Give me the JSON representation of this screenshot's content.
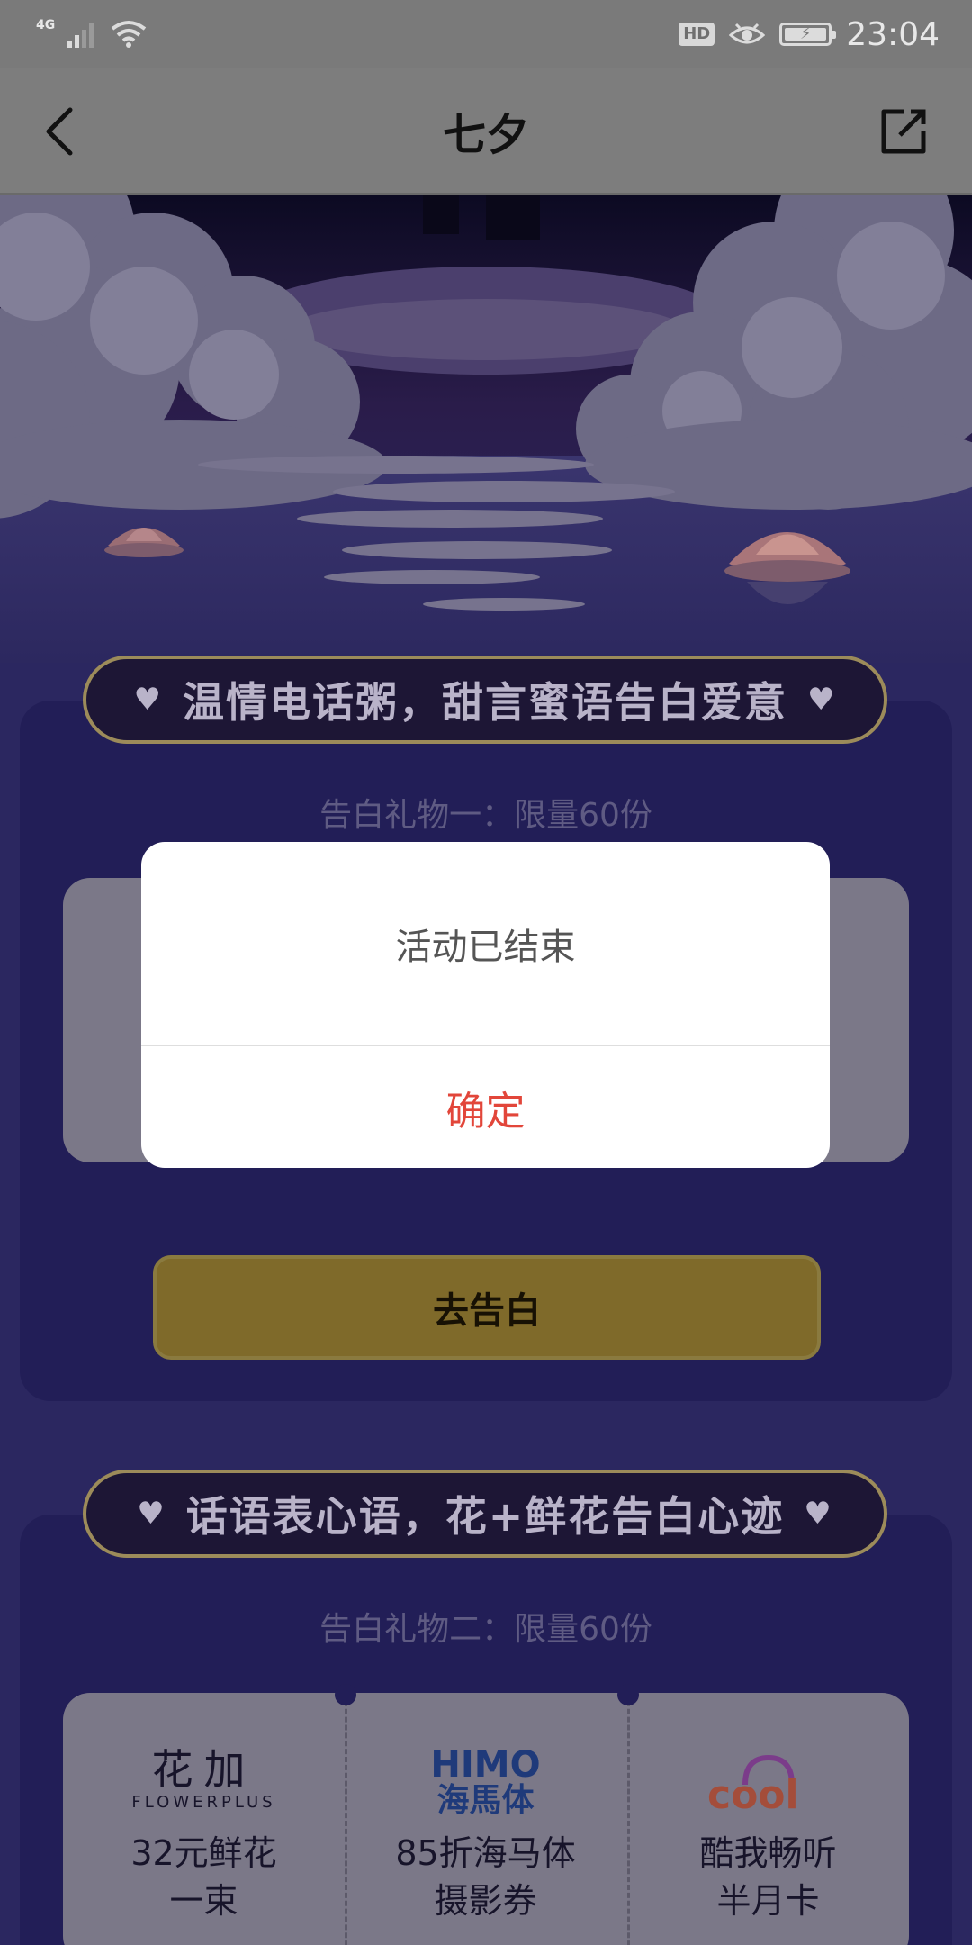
{
  "status_bar": {
    "network": "4G",
    "hd_badge": "HD",
    "time": "23:04",
    "icons": [
      "signal-icon",
      "wifi-icon",
      "eye-comfort-icon",
      "battery-charging-icon"
    ]
  },
  "header": {
    "title": "七夕",
    "back_icon": "chevron-left-icon",
    "share_icon": "share-external-icon"
  },
  "section1": {
    "banner": "温情电话粥，甜言蜜语告白爱意",
    "gift_label": "告白礼物一：限量60份",
    "button_label": "去告白"
  },
  "section2": {
    "banner": "话语表心语，花+鲜花告白心迹",
    "gift_label": "告白礼物二：限量60份",
    "gifts": [
      {
        "brand_main": "花加",
        "brand_sub": "FLOWERPLUS",
        "name_line1": "32元鲜花",
        "name_line2": "一束"
      },
      {
        "brand_main": "HIMO",
        "brand_sub": "海馬体",
        "name_line1": "85折海马体",
        "name_line2": "摄影券"
      },
      {
        "brand_main": "cool",
        "brand_sub": "",
        "name_line1": "酷我畅听",
        "name_line2": "半月卡"
      }
    ]
  },
  "dialog": {
    "message": "活动已结束",
    "confirm_label": "确定"
  },
  "colors": {
    "confirm_text": "#e2463a",
    "page_background": "#2b2760",
    "banner_border": "#9c8b5a",
    "button_gold": "#7f6a2a"
  }
}
